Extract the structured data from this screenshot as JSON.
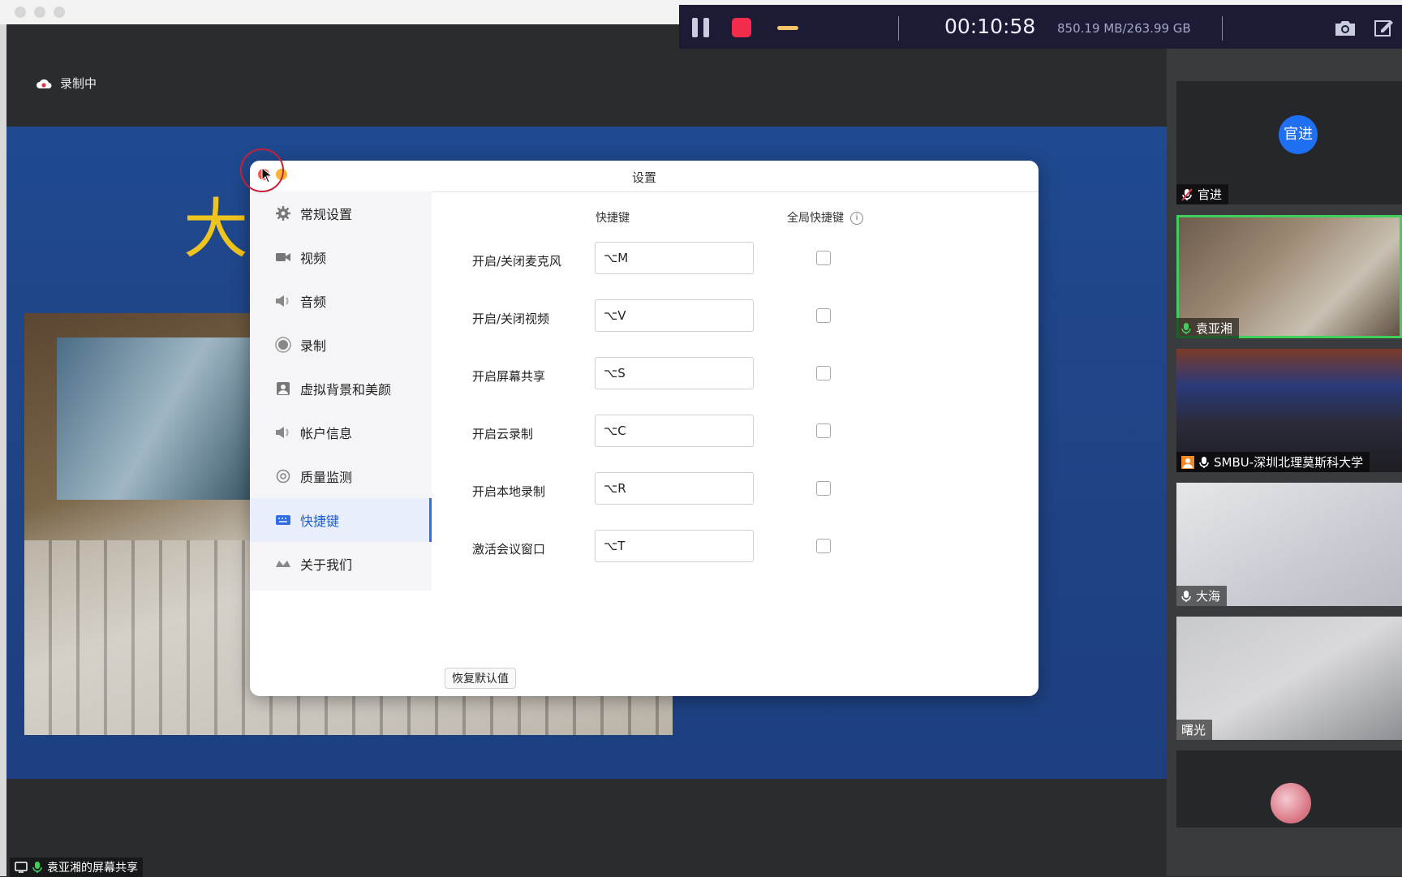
{
  "recorder": {
    "elapsed": "00:10:58",
    "storage": "850.19 MB/263.99 GB",
    "colors": {
      "bar": "#1c1a35",
      "stop": "#f22c4a",
      "minimize": "#f4c46a"
    }
  },
  "meeting": {
    "recording_status": "录制中",
    "share_label": "袁亚湘的屏幕共享",
    "slide_title_char": "大"
  },
  "settings": {
    "title": "设置",
    "nav": [
      {
        "label": "常规设置",
        "icon": "gear-icon"
      },
      {
        "label": "视频",
        "icon": "video-camera-icon"
      },
      {
        "label": "音频",
        "icon": "speaker-icon"
      },
      {
        "label": "录制",
        "icon": "record-icon"
      },
      {
        "label": "虚拟背景和美颜",
        "icon": "portrait-icon"
      },
      {
        "label": "帐户信息",
        "icon": "speaker-icon"
      },
      {
        "label": "质量监测",
        "icon": "gauge-icon"
      },
      {
        "label": "快捷键",
        "icon": "keyboard-icon",
        "active": true
      },
      {
        "label": "关于我们",
        "icon": "logo-icon"
      }
    ],
    "columns": {
      "shortcut": "快捷键",
      "global": "全局快捷键"
    },
    "shortcuts": [
      {
        "label": "开启/关闭麦克风",
        "key": "⌥M",
        "global": false
      },
      {
        "label": "开启/关闭视频",
        "key": "⌥V",
        "global": false
      },
      {
        "label": "开启屏幕共享",
        "key": "⌥S",
        "global": false
      },
      {
        "label": "开启云录制",
        "key": "⌥C",
        "global": false
      },
      {
        "label": "开启本地录制",
        "key": "⌥R",
        "global": false
      },
      {
        "label": "激活会议窗口",
        "key": "⌥T",
        "global": false
      }
    ],
    "reset_label": "恢复默认值",
    "accent": "#2f6ee5"
  },
  "participants": [
    {
      "name": "官进",
      "avatar_text": "官进",
      "muted": true
    },
    {
      "name": "袁亚湘",
      "speaking": true
    },
    {
      "name": "SMBU-深圳北理莫斯科大学"
    },
    {
      "name": "大海"
    },
    {
      "name": "曙光"
    },
    {
      "name": ""
    }
  ]
}
